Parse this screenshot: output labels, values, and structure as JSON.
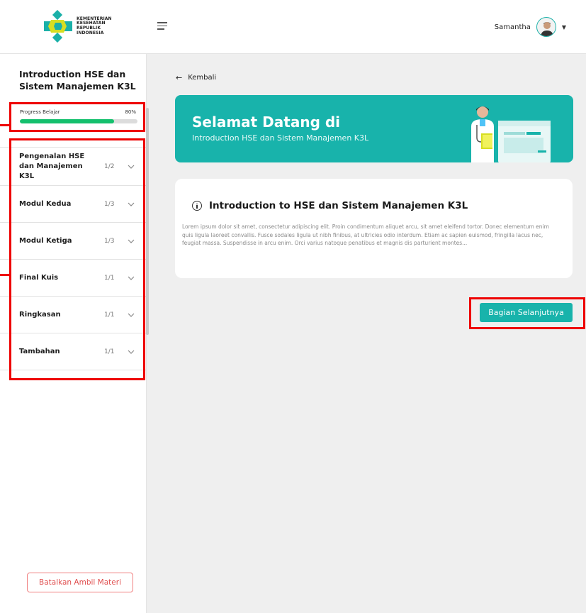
{
  "header": {
    "logo_lines": [
      "KEMENTERIAN",
      "KESEHATAN",
      "REPUBLIK",
      "INDONESIA"
    ],
    "user_name": "Samantha",
    "icons": [
      "hamburger-menu-icon",
      "avatar",
      "caret-down-icon"
    ]
  },
  "sidebar": {
    "course_title": "Introduction  HSE dan Sistem Manajemen K3L",
    "progress": {
      "label": "Progress Belajar",
      "percent_text": "80%",
      "value": 0.8,
      "color": "#14c06d"
    },
    "modules": [
      {
        "name": "Pengenalan HSE dan Manajemen K3L",
        "count": "1/2"
      },
      {
        "name": "Modul Kedua",
        "count": "1/3"
      },
      {
        "name": "Modul Ketiga",
        "count": "1/3"
      },
      {
        "name": "Final Kuis",
        "count": "1/1"
      },
      {
        "name": "Ringkasan",
        "count": "1/1"
      },
      {
        "name": "Tambahan",
        "count": "1/1"
      }
    ],
    "cancel_label": "Batalkan Ambil Materi"
  },
  "main": {
    "back_label": "Kembali",
    "banner": {
      "title": "Selamat Datang di",
      "subtitle": "Introduction HSE dan Sistem Manajemen K3L"
    },
    "card": {
      "title": "Introduction to HSE dan Sistem Manajemen K3L",
      "body": "Lorem ipsum dolor sit amet, consectetur adipiscing elit. Proin condimentum aliquet arcu, sit amet eleifend tortor. Donec elementum enim quis ligula laoreet convallis. Fusce sodales ligula ut nibh finibus, at ultricies odio interdum. Etiam ac sapien euismod, fringilla lacus nec, feugiat massa. Suspendisse in arcu enim. Orci varius natoque penatibus et magnis dis parturient montes..."
    },
    "next_label": "Bagian Selanjutnya"
  },
  "colors": {
    "accent": "#18b3ab",
    "highlight": "#ee0000",
    "progress": "#14c06d"
  }
}
